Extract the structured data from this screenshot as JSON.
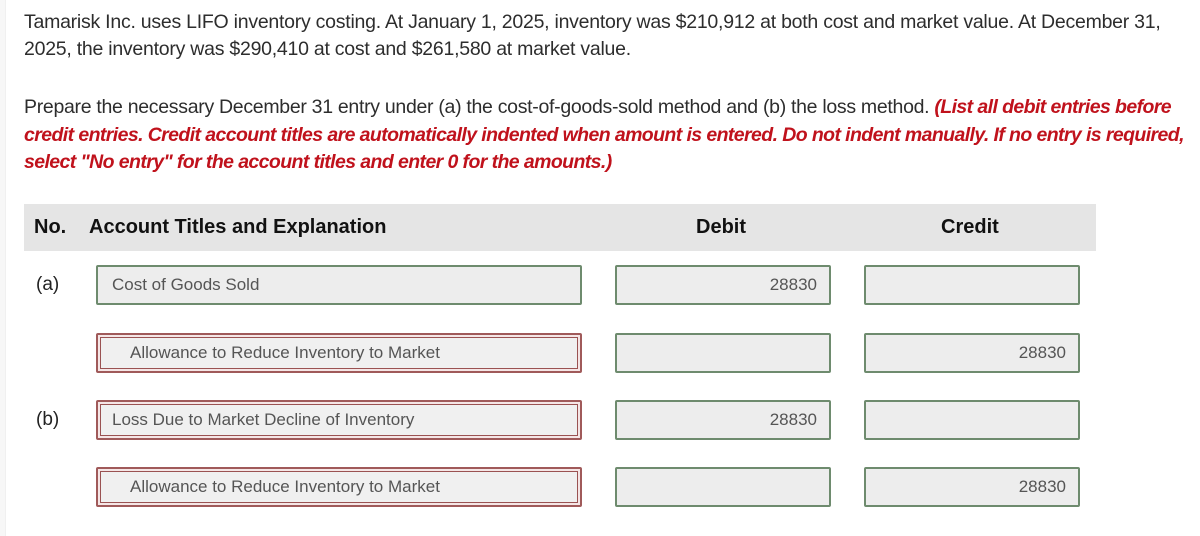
{
  "problem": {
    "text": "Tamarisk Inc. uses LIFO inventory costing. At January 1, 2025, inventory was $210,912 at both cost and market value. At December 31, 2025, the inventory was $290,410 at cost and $261,580 at market value."
  },
  "instructions": {
    "prompt": "Prepare the necessary December 31 entry under (a) the cost-of-goods-sold method and (b) the loss method. ",
    "note": "(List all debit entries before credit entries. Credit account titles are automatically indented when amount is entered. Do not indent manually. If no entry is required, select \"No entry\" for the account titles and enter 0 for the amounts.)"
  },
  "table": {
    "headers": {
      "no": "No.",
      "account": "Account Titles and Explanation",
      "debit": "Debit",
      "credit": "Credit"
    },
    "rows": [
      {
        "no": "(a)",
        "account": "Cost of Goods Sold",
        "debit": "28830",
        "credit": "",
        "account_status": "correct",
        "indented": false
      },
      {
        "no": "",
        "account": "Allowance to Reduce Inventory to Market",
        "debit": "",
        "credit": "28830",
        "account_status": "incorrect",
        "indented": true
      },
      {
        "no": "(b)",
        "account": "Loss Due to Market Decline of Inventory",
        "debit": "28830",
        "credit": "",
        "account_status": "incorrect",
        "indented": false
      },
      {
        "no": "",
        "account": "Allowance to Reduce Inventory to Market",
        "debit": "",
        "credit": "28830",
        "account_status": "incorrect",
        "indented": true
      }
    ]
  },
  "colors": {
    "correct_border": "#6e8b6e",
    "incorrect_border": "#a05a5a",
    "instruction_red": "#c0121c",
    "header_bg": "#e5e5e5",
    "field_bg": "#ededed"
  }
}
